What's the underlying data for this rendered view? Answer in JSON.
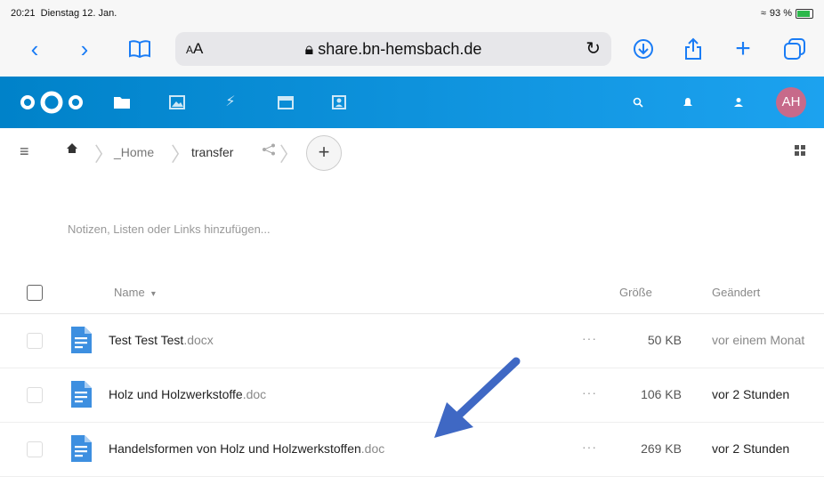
{
  "status": {
    "time": "20:21",
    "date": "Dienstag 12. Jan.",
    "battery": "93 %"
  },
  "safari": {
    "text_size": "AA",
    "url": "share.bn-hemsbach.de"
  },
  "nextcloud": {
    "brand_color": "#0082c9",
    "apps": [
      "folder-icon",
      "image-icon",
      "activity-icon",
      "calendar-icon",
      "contacts-icon"
    ],
    "avatar": "AH"
  },
  "breadcrumb": {
    "home": "_Home",
    "current": "transfer",
    "add": "+"
  },
  "notes_placeholder": "Notizen, Listen oder Links hinzufügen...",
  "table": {
    "headers": {
      "name": "Name",
      "sort": "▾",
      "size": "Größe",
      "modified": "Geändert"
    },
    "rows": [
      {
        "base": "Test Test Test",
        "ext": ".docx",
        "size": "50 KB",
        "modified": "vor einem Monat",
        "recent": false
      },
      {
        "base": "Holz und Holzwerkstoffe",
        "ext": ".doc",
        "size": "106 KB",
        "modified": "vor 2 Stunden",
        "recent": true
      },
      {
        "base": "Handelsformen von Holz und Holzwerkstoffen",
        "ext": ".doc",
        "size": "269 KB",
        "modified": "vor 2 Stunden",
        "recent": true
      }
    ]
  }
}
